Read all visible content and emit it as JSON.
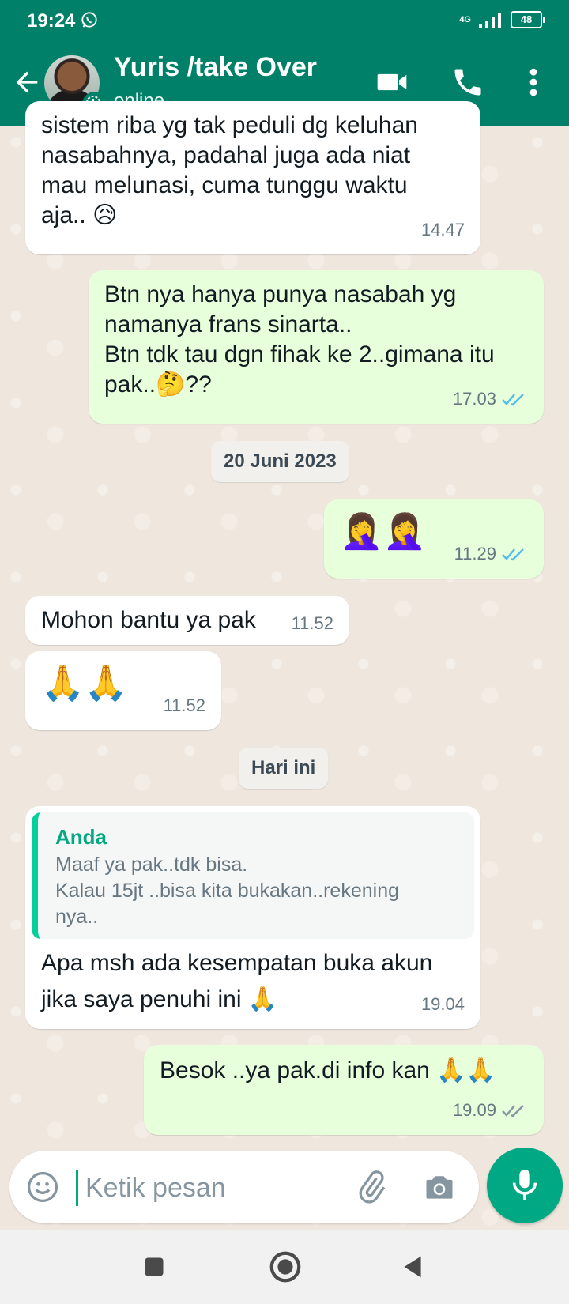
{
  "status_bar": {
    "time": "19:24",
    "network": "4G",
    "battery": "48"
  },
  "header": {
    "contact_name": "Yuris /take Over",
    "contact_status": "online"
  },
  "messages": [
    {
      "direction": "in",
      "text": "sistem riba yg tak peduli dg keluhan\nnasabahnya, padahal juga ada niat\nmau melunasi, cuma tunggu waktu\naja.. 😥",
      "time": "14.47"
    },
    {
      "direction": "out",
      "text": "Btn nya hanya punya nasabah yg\nnamanya frans sinarta..\nBtn tdk tau dgn fihak ke 2..gimana itu\npak..🤔??",
      "time": "17.03",
      "status": "read"
    },
    {
      "direction": "out",
      "text": "🤦‍♀️🤦‍♀️",
      "time": "11.29",
      "status": "read"
    },
    {
      "direction": "in",
      "text": "Mohon bantu ya pak",
      "time": "11.52"
    },
    {
      "direction": "in",
      "text": "🙏🙏",
      "time": "11.52"
    },
    {
      "direction": "in",
      "quote_author": "Anda",
      "quote_text": "Maaf ya pak..tdk bisa.\nKalau 15jt ..bisa kita bukakan..rekening\nnya..",
      "text": "Apa msh ada kesempatan buka akun\njika saya penuhi ini 🙏",
      "time": "19.04"
    },
    {
      "direction": "out",
      "text": "Besok ..ya pak.di info kan 🙏🙏",
      "time": "19.09",
      "status": "delivered"
    }
  ],
  "date_chips": [
    "20 Juni 2023",
    "Hari ini"
  ],
  "composer": {
    "placeholder": "Ketik pesan"
  },
  "colors": {
    "header": "#008069",
    "outgoing_bubble": "#e7ffdb",
    "incoming_bubble": "#ffffff",
    "read_ticks": "#53bdeb",
    "delivered_ticks": "#8696a0",
    "accent": "#00a884"
  },
  "icons": [
    "whatsapp-icon",
    "back-arrow-icon",
    "video-call-icon",
    "phone-call-icon",
    "more-menu-icon",
    "emoji-icon",
    "attach-icon",
    "camera-icon",
    "microphone-icon",
    "double-check-icon",
    "recent-apps-icon",
    "home-icon",
    "back-nav-icon"
  ]
}
